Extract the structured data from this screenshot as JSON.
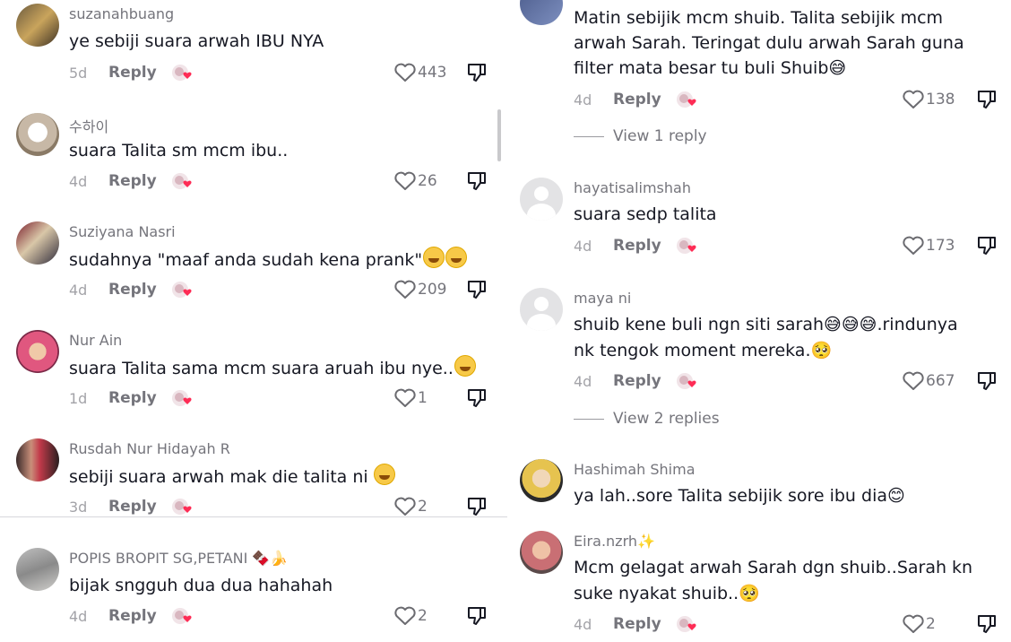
{
  "left": {
    "comments": [
      {
        "username": "suzanahbuang",
        "text": "ye sebiji suara arwah IBU NYA",
        "emojis": "",
        "date": "5d",
        "reply_label": "Reply",
        "likes": "443"
      },
      {
        "username": "수하이",
        "text": "suara Talita sm mcm ibu..",
        "emojis": "",
        "date": "4d",
        "reply_label": "Reply",
        "likes": "26"
      },
      {
        "username": "Suziyana Nasri",
        "text": "sudahnya \"maaf anda sudah kena prank\"",
        "emojis": "😂😂",
        "date": "4d",
        "reply_label": "Reply",
        "likes": "209"
      },
      {
        "username": "Nur Ain",
        "text": "suara Talita sama mcm suara aruah ibu nye..",
        "emojis": "🥰",
        "date": "1d",
        "reply_label": "Reply",
        "likes": "1"
      },
      {
        "username": "Rusdah Nur Hidayah R",
        "text": "sebiji suara arwah mak die talita ni",
        "emojis": "😂",
        "date": "3d",
        "reply_label": "Reply",
        "likes": "2"
      },
      {
        "username": "POPIS BROPIT SG,PETANI",
        "username_emoji": "🍫🍌",
        "text": "bijak sngguh dua dua hahahah",
        "emojis": "",
        "date": "4d",
        "reply_label": "Reply",
        "likes": "2"
      }
    ]
  },
  "right": {
    "comments": [
      {
        "username": "",
        "text_lines": [
          "Matin sebijik mcm shuib. Talita sebijik mcm",
          "arwah Sarah. Teringat dulu arwah Sarah guna",
          "filter mata besar tu buli Shuib😅"
        ],
        "date": "4d",
        "reply_label": "Reply",
        "likes": "138",
        "view_replies": "View 1 reply"
      },
      {
        "username": "hayatisalimshah",
        "text_lines": [
          "suara sedp talita"
        ],
        "date": "4d",
        "reply_label": "Reply",
        "likes": "173",
        "view_replies": ""
      },
      {
        "username": "maya ni",
        "text_lines": [
          "shuib kene buli ngn siti sarah😅😅😅.rindunya",
          "nk tengok moment mereka.🥺"
        ],
        "date": "4d",
        "reply_label": "Reply",
        "likes": "667",
        "view_replies": "View 2 replies"
      },
      {
        "username": "Hashimah Shima",
        "text_lines": [
          "ya lah..sore Talita sebijik sore ibu dia😊"
        ],
        "date": "",
        "reply_label": "",
        "likes": "",
        "view_replies": ""
      },
      {
        "username": "Eira.nzrh✨",
        "text_lines": [
          "Mcm gelagat arwah Sarah dgn shuib..Sarah kn",
          "suke nyakat shuib..🥺"
        ],
        "date": "4d",
        "reply_label": "Reply",
        "likes": "2",
        "view_replies": ""
      }
    ]
  },
  "icons": {
    "heart": "heart-outline-icon",
    "dislike": "thumbs-down-icon",
    "sticker": "creator-liked-sticker-icon"
  },
  "colors": {
    "text": "#161823",
    "secondary": "#75757c",
    "date": "#a3a3a8",
    "accent": "#fe2c55"
  }
}
